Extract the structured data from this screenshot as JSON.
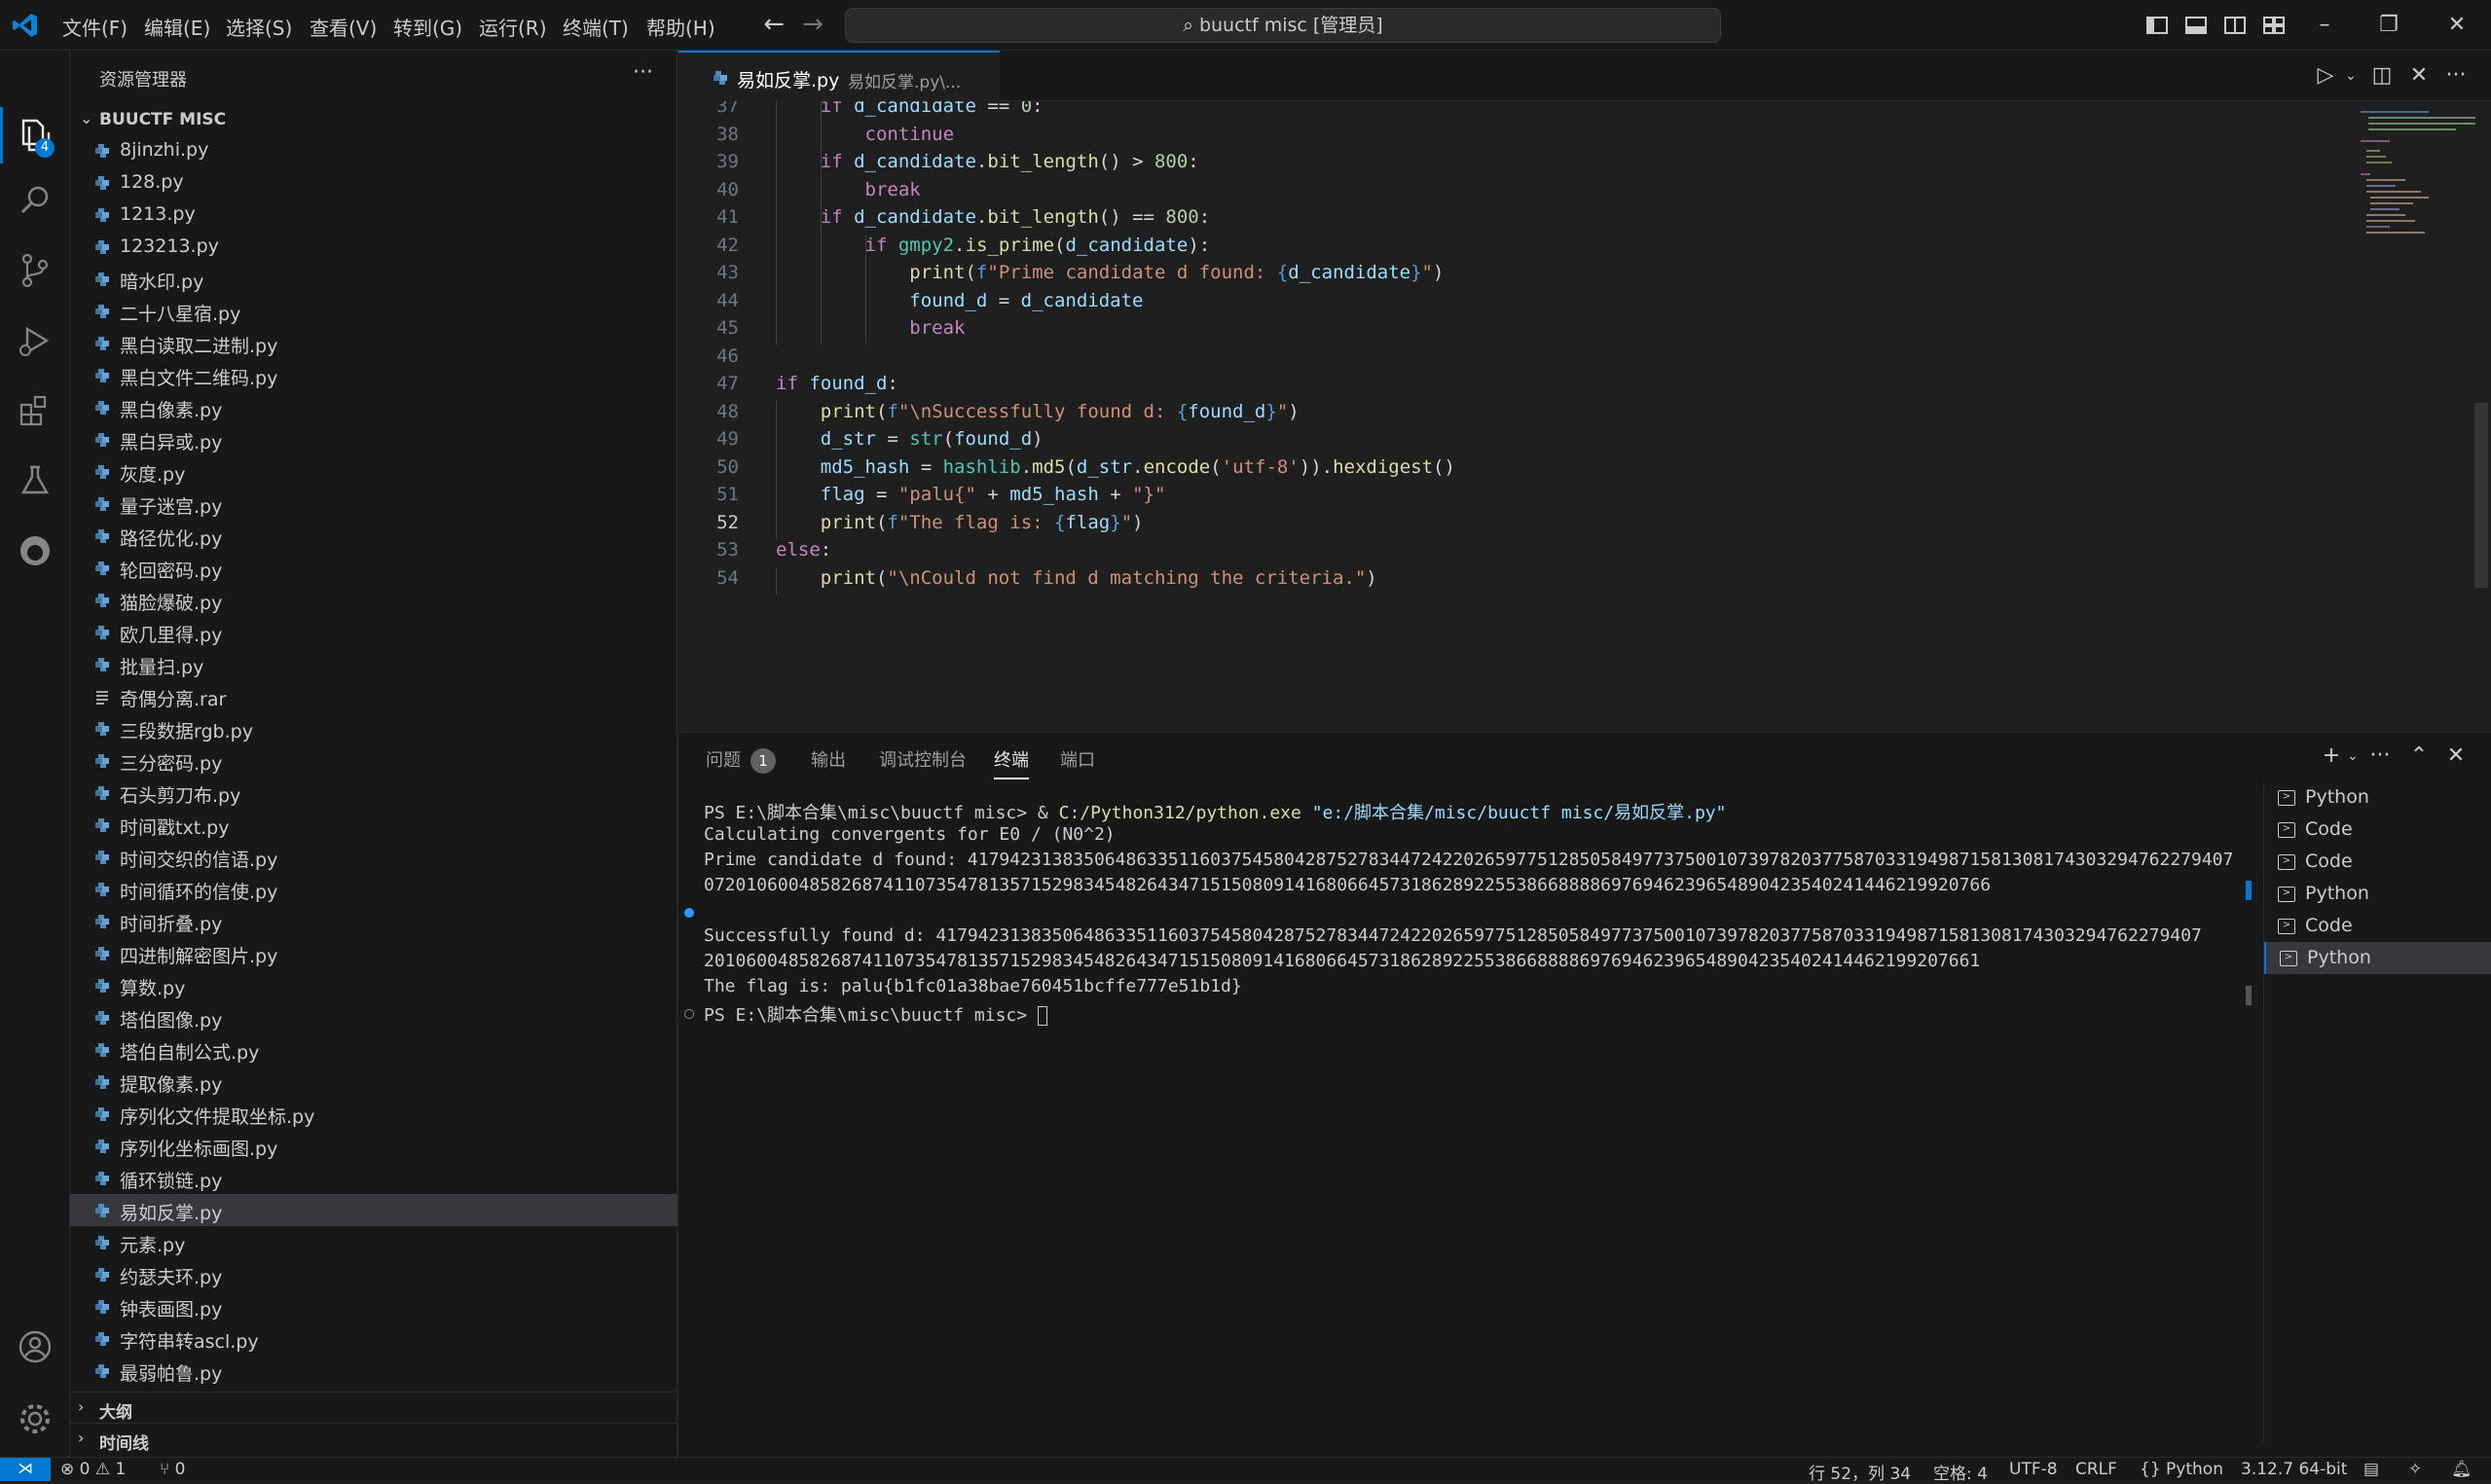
{
  "menu": [
    "文件(F)",
    "编辑(E)",
    "选择(S)",
    "查看(V)",
    "转到(G)",
    "运行(R)",
    "终端(T)",
    "帮助(H)"
  ],
  "command_center": "buuctf misc [管理员]",
  "activity_badge": "4",
  "sidebar": {
    "title": "资源管理器",
    "more": "···",
    "folder": "BUUCTF MISC",
    "files": [
      "8jinzhi.py",
      "128.py",
      "1213.py",
      "123213.py",
      "暗水印.py",
      "二十八星宿.py",
      "黑白读取二进制.py",
      "黑白文件二维码.py",
      "黑白像素.py",
      "黑白异或.py",
      "灰度.py",
      "量子迷宫.py",
      "路径优化.py",
      "轮回密码.py",
      "猫脸爆破.py",
      "欧几里得.py",
      "批量扫.py",
      "奇偶分离.rar",
      "三段数据rgb.py",
      "三分密码.py",
      "石头剪刀布.py",
      "时间戳txt.py",
      "时间交织的信语.py",
      "时间循环的信使.py",
      "时间折叠.py",
      "四进制解密图片.py",
      "算数.py",
      "塔伯图像.py",
      "塔伯自制公式.py",
      "提取像素.py",
      "序列化文件提取坐标.py",
      "序列化坐标画图.py",
      "循环锁链.py",
      "易如反掌.py",
      "元素.py",
      "约瑟夫环.py",
      "钟表画图.py",
      "字符串转ascl.py",
      "最弱帕鲁.py"
    ],
    "selected_file": "易如反掌.py",
    "outline": "大纲",
    "timeline": "时间线"
  },
  "editor": {
    "tab_name": "易如反掌.py",
    "tab_desc": "易如反掌.py\\...",
    "current_line": "52",
    "lines": [
      {
        "n": "37",
        "parts": [
          [
            "kw",
            "    if "
          ],
          [
            "vr",
            "d_candidate"
          ],
          [
            "op",
            " == "
          ],
          [
            "nm",
            "0"
          ],
          [
            "op",
            ":"
          ]
        ]
      },
      {
        "n": "38",
        "parts": [
          [
            "kw",
            "        continue"
          ]
        ]
      },
      {
        "n": "39",
        "parts": [
          [
            "kw",
            "    if "
          ],
          [
            "vr",
            "d_candidate"
          ],
          [
            "op",
            "."
          ],
          [
            "fn",
            "bit_length"
          ],
          [
            "op",
            "() > "
          ],
          [
            "nm",
            "800"
          ],
          [
            "op",
            ":"
          ]
        ]
      },
      {
        "n": "40",
        "parts": [
          [
            "kw",
            "        break"
          ]
        ]
      },
      {
        "n": "41",
        "parts": [
          [
            "kw",
            "    if "
          ],
          [
            "vr",
            "d_candidate"
          ],
          [
            "op",
            "."
          ],
          [
            "fn",
            "bit_length"
          ],
          [
            "op",
            "() == "
          ],
          [
            "nm",
            "800"
          ],
          [
            "op",
            ":"
          ]
        ]
      },
      {
        "n": "42",
        "parts": [
          [
            "kw",
            "        if "
          ],
          [
            "bi",
            "gmpy2"
          ],
          [
            "op",
            "."
          ],
          [
            "fn",
            "is_prime"
          ],
          [
            "op",
            "("
          ],
          [
            "vr",
            "d_candidate"
          ],
          [
            "op",
            "):"
          ]
        ]
      },
      {
        "n": "43",
        "parts": [
          [
            "fn",
            "            print"
          ],
          [
            "op",
            "("
          ],
          [
            "bl",
            "f"
          ],
          [
            "st",
            "\"Prime candidate d found: "
          ],
          [
            "bl",
            "{"
          ],
          [
            "vr",
            "d_candidate"
          ],
          [
            "bl",
            "}"
          ],
          [
            "st",
            "\""
          ],
          [
            "op",
            ")"
          ]
        ]
      },
      {
        "n": "44",
        "parts": [
          [
            "vr",
            "            found_d"
          ],
          [
            "op",
            " = "
          ],
          [
            "vr",
            "d_candidate"
          ]
        ]
      },
      {
        "n": "45",
        "parts": [
          [
            "kw",
            "            break"
          ]
        ]
      },
      {
        "n": "46",
        "parts": [
          [
            "op",
            ""
          ]
        ]
      },
      {
        "n": "47",
        "parts": [
          [
            "kw",
            "if "
          ],
          [
            "vr",
            "found_d"
          ],
          [
            "op",
            ":"
          ]
        ]
      },
      {
        "n": "48",
        "parts": [
          [
            "fn",
            "    print"
          ],
          [
            "op",
            "("
          ],
          [
            "bl",
            "f"
          ],
          [
            "st",
            "\"\\nSuccessfully found d: "
          ],
          [
            "bl",
            "{"
          ],
          [
            "vr",
            "found_d"
          ],
          [
            "bl",
            "}"
          ],
          [
            "st",
            "\""
          ],
          [
            "op",
            ")"
          ]
        ]
      },
      {
        "n": "49",
        "parts": [
          [
            "vr",
            "    d_str"
          ],
          [
            "op",
            " = "
          ],
          [
            "bi",
            "str"
          ],
          [
            "op",
            "("
          ],
          [
            "vr",
            "found_d"
          ],
          [
            "op",
            ")"
          ]
        ]
      },
      {
        "n": "50",
        "parts": [
          [
            "vr",
            "    md5_hash"
          ],
          [
            "op",
            " = "
          ],
          [
            "bi",
            "hashlib"
          ],
          [
            "op",
            "."
          ],
          [
            "fn",
            "md5"
          ],
          [
            "op",
            "("
          ],
          [
            "vr",
            "d_str"
          ],
          [
            "op",
            "."
          ],
          [
            "fn",
            "encode"
          ],
          [
            "op",
            "("
          ],
          [
            "st",
            "'utf-8'"
          ],
          [
            "op",
            "))."
          ],
          [
            "fn",
            "hexdigest"
          ],
          [
            "op",
            "()"
          ]
        ]
      },
      {
        "n": "51",
        "parts": [
          [
            "vr",
            "    flag"
          ],
          [
            "op",
            " = "
          ],
          [
            "st",
            "\"palu{\""
          ],
          [
            "op",
            " + "
          ],
          [
            "vr",
            "md5_hash"
          ],
          [
            "op",
            " + "
          ],
          [
            "st",
            "\"}\""
          ]
        ]
      },
      {
        "n": "52",
        "parts": [
          [
            "fn",
            "    print"
          ],
          [
            "op",
            "("
          ],
          [
            "bl",
            "f"
          ],
          [
            "st",
            "\"The flag is: "
          ],
          [
            "bl",
            "{"
          ],
          [
            "vr",
            "flag"
          ],
          [
            "bl",
            "}"
          ],
          [
            "st",
            "\""
          ],
          [
            "op",
            ")"
          ]
        ]
      },
      {
        "n": "53",
        "parts": [
          [
            "kw",
            "else"
          ],
          [
            "op",
            ":"
          ]
        ]
      },
      {
        "n": "54",
        "parts": [
          [
            "fn",
            "    print"
          ],
          [
            "op",
            "("
          ],
          [
            "st",
            "\"\\nCould not find d matching the criteria.\""
          ],
          [
            "op",
            ")"
          ]
        ]
      }
    ]
  },
  "panel": {
    "tabs": [
      "问题",
      "输出",
      "调试控制台",
      "终端",
      "端口"
    ],
    "problems_count": "1",
    "active_tab": "终端",
    "terminal_lines": [
      {
        "dot": "",
        "segments": [
          [
            "#cccccc",
            "PS E:\\脚本合集\\misc\\buuctf misc> & "
          ],
          [
            "#dcdcaa",
            "C:/Python312/python.exe"
          ],
          [
            "#cccccc",
            " "
          ],
          [
            "#9cdcfe",
            "\"e:/脚本合集/misc/buuctf misc/易如反掌.py\""
          ]
        ]
      },
      {
        "dot": "",
        "segments": [
          [
            "#cccccc",
            "Calculating convergents for E0 / (N0^2)"
          ]
        ]
      },
      {
        "dot": "",
        "segments": [
          [
            "#cccccc",
            "Prime candidate d found: 417942313835064863351160375458042875278344724220265977512850584977375001073978203775870331949871581308174303294762279407"
          ]
        ]
      },
      {
        "dot": "",
        "segments": [
          [
            "#cccccc",
            "07201060048582687411073547813571529834548264347151508091416806645731862892255386688886976946239654890423540241446219920766"
          ]
        ]
      },
      {
        "dot": "blue",
        "segments": [
          [
            "#cccccc",
            ""
          ]
        ]
      },
      {
        "dot": "",
        "segments": [
          [
            "#cccccc",
            "Successfully found d: 417942313835064863351160375458042875278344724220265977512850584977375001073978203775870331949871581308174303294762279407"
          ]
        ]
      },
      {
        "dot": "",
        "segments": [
          [
            "#cccccc",
            "2010600485826874110735478135715298345482643471515080914168066457318628922553866888869769462396548904235402414462199207661"
          ]
        ]
      },
      {
        "dot": "",
        "segments": [
          [
            "#cccccc",
            "The flag is: palu{b1fc01a38bae760451bcffe777e51b1d}"
          ]
        ]
      },
      {
        "dot": "hollow",
        "segments": [
          [
            "#cccccc",
            "PS E:\\脚本合集\\misc\\buuctf misc> "
          ]
        ]
      }
    ],
    "terminals": [
      "Python",
      "Code",
      "Code",
      "Python",
      "Code",
      "Python"
    ],
    "selected_terminal_index": 5
  },
  "status": {
    "errors": "0",
    "warnings": "1",
    "ports": "0",
    "position": "行 52，列 34",
    "indent": "空格: 4",
    "encoding": "UTF-8",
    "eol": "CRLF",
    "language": "{} Python",
    "interpreter": "3.12.7 64-bit"
  },
  "colors": {
    "accent": "#0078d4",
    "background": "#1f1f1f",
    "sidebar": "#181818"
  },
  "icons": [
    "vscode-logo-icon",
    "explorer-icon",
    "search-icon",
    "source-control-icon",
    "run-debug-icon",
    "extensions-icon",
    "testing-icon",
    "github-icon",
    "account-icon",
    "settings-gear-icon",
    "python-file-icon",
    "text-file-icon",
    "terminal-icon"
  ]
}
